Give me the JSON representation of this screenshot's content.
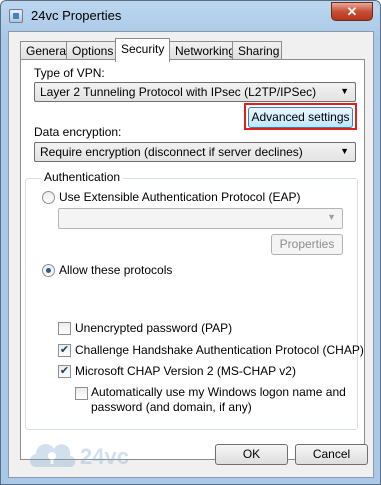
{
  "window": {
    "title": "24vc Properties",
    "close_glyph": "✕"
  },
  "tabs": [
    {
      "label": "General",
      "active": false
    },
    {
      "label": "Options",
      "active": false
    },
    {
      "label": "Security",
      "active": true
    },
    {
      "label": "Networking",
      "active": false
    },
    {
      "label": "Sharing",
      "active": false
    }
  ],
  "vpn": {
    "label": "Type of VPN:",
    "value": "Layer 2 Tunneling Protocol with IPsec (L2TP/IPSec)",
    "advanced_button": "Advanced settings"
  },
  "encryption": {
    "label": "Data encryption:",
    "value": "Require encryption (disconnect if server declines)"
  },
  "authentication": {
    "legend": "Authentication",
    "eap_option": {
      "label": "Use Extensible Authentication Protocol (EAP)",
      "selected": false
    },
    "eap_value": "",
    "properties_button": "Properties",
    "protocols_option": {
      "label": "Allow these protocols",
      "selected": true
    },
    "protocols": [
      {
        "label": "Unencrypted password (PAP)",
        "checked": false
      },
      {
        "label": "Challenge Handshake Authentication Protocol (CHAP)",
        "checked": true
      },
      {
        "label": "Microsoft CHAP Version 2 (MS-CHAP v2)",
        "checked": true
      }
    ],
    "windows_logon": {
      "label_line1": "Automatically use my Windows logon name and",
      "label_line2": "password (and domain, if any)",
      "checked": false
    }
  },
  "footer": {
    "ok_button": "OK",
    "cancel_button": "Cancel"
  },
  "watermark": {
    "text": "24vc"
  },
  "colors": {
    "highlight": "#e0201b",
    "title_bar": "#a9c7e6",
    "close_button": "#c74f35"
  },
  "glyphs": {
    "dropdown_arrow": "▼",
    "check_mark": "✔"
  }
}
